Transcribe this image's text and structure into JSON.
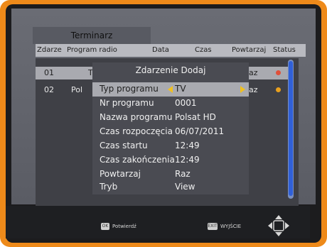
{
  "window": {
    "title": "Terminarz"
  },
  "table": {
    "columns": [
      "Zdarze",
      "Program radio",
      "Data",
      "Czas",
      "Powtarzaj",
      "Status"
    ],
    "rows": [
      {
        "id": "01",
        "program": "TV",
        "repeat": "az",
        "status_color": "#e0503a"
      },
      {
        "id": "02",
        "program": "Pol",
        "repeat": "az",
        "status_color": "#e8a01e"
      }
    ]
  },
  "dialog": {
    "title": "Zdarzenie Dodaj",
    "fields": [
      {
        "label": "Typ programu",
        "value": "TV"
      },
      {
        "label": "Nr programu",
        "value": "0001"
      },
      {
        "label": "Nazwa programu",
        "value": "Polsat HD"
      },
      {
        "label": "Czas rozpoczęcia",
        "value": "06/07/2011"
      },
      {
        "label": "Czas startu",
        "value": "12:49"
      },
      {
        "label": "Czas zakończenia",
        "value": "12:49"
      },
      {
        "label": "Powtarzaj",
        "value": "Raz"
      },
      {
        "label": "Tryb",
        "value": "View"
      }
    ]
  },
  "footer": {
    "ok_key": "OK",
    "ok_label": "Potwierdź",
    "exit_key": "EXIT",
    "exit_label": "WYJŚCIE"
  },
  "colors": {
    "frame": "#ee8a1a",
    "highlight": "#a9aab0",
    "arrow": "#f0c020",
    "scrollbar": "#3060d8"
  },
  "icons": {
    "navigation": "dpad-icon",
    "field_arrows": "arrow-left-right-icon"
  }
}
